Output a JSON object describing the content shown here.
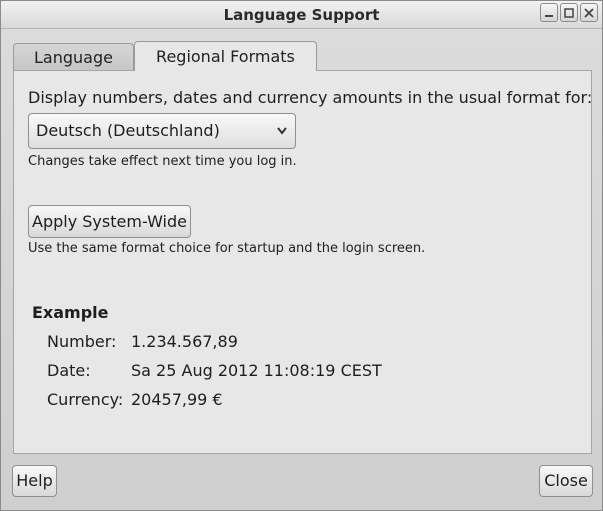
{
  "window": {
    "title": "Language Support"
  },
  "tabs": [
    {
      "label": "Language",
      "active": false
    },
    {
      "label": "Regional Formats",
      "active": true
    }
  ],
  "regional": {
    "instruction": "Display numbers, dates and currency amounts in the usual format for:",
    "selected_locale": "Deutsch (Deutschland)",
    "change_note": "Changes take effect next time you log in.",
    "apply_button": "Apply System-Wide",
    "apply_note": "Use the same format choice for startup and the login screen."
  },
  "example": {
    "title": "Example",
    "rows": [
      {
        "key": "Number:",
        "value": "1.234.567,89"
      },
      {
        "key": "Date:",
        "value": "Sa 25 Aug 2012 11:08:19 CEST"
      },
      {
        "key": "Currency:",
        "value": "20457,99 €"
      }
    ]
  },
  "footer": {
    "help_label": "Help",
    "close_label": "Close"
  },
  "icons": {
    "minimize": "minimize-icon",
    "maximize": "maximize-icon",
    "close": "close-icon",
    "dropdown": "chevron-down-icon"
  }
}
